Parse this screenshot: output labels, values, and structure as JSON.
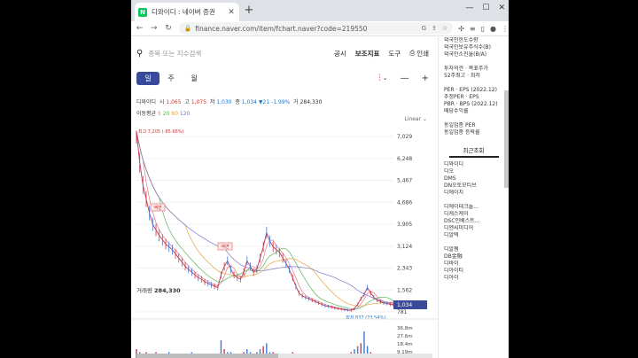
{
  "browser": {
    "tab_title": "디와이디 : 네이버 증권",
    "url": "finance.naver.com/item/fchart.naver?code=219550",
    "new_tab": "+",
    "tab_close": "✕"
  },
  "search": {
    "placeholder": "종목 또는 지수검색"
  },
  "menu": {
    "notice": "공시",
    "indicator": "보조지표",
    "tools": "도구",
    "print": "인쇄"
  },
  "periods": {
    "day": "일",
    "week": "주",
    "month": "월"
  },
  "stock": {
    "name": "디와이디",
    "open_label": "시",
    "open": "1,065",
    "high_label": "고",
    "high": "1,075",
    "low_label": "저",
    "low": "1,030",
    "close_label": "종",
    "close": "1,034",
    "change": "▼21",
    "change_pct": "-1.99%",
    "volume_label": "거",
    "volume": "284,330"
  },
  "ma": {
    "label": "이동평균",
    "v5": "5",
    "v20": "20",
    "v60": "60",
    "v120": "120"
  },
  "scale_mode": "Linear",
  "chart_data": {
    "type": "line",
    "y_ticks": [
      "7,029",
      "6,248",
      "5,467",
      "4,686",
      "3,905",
      "3,124",
      "2,343",
      "1,562",
      "781"
    ],
    "x_ticks": [
      "4월",
      "8월",
      "2022",
      "4월",
      "8월",
      "2023",
      "4월"
    ],
    "ylim": [
      781,
      7029
    ],
    "high_label": "최고 7,205 (-85.66%)",
    "low_label": "최저 837 (23.54%)",
    "last_price": "1,034",
    "annotations": [
      "액면",
      "액면"
    ],
    "price_series": [
      7205,
      6100,
      5300,
      4800,
      4300,
      3900,
      3700,
      3500,
      3350,
      3200,
      3100,
      3000,
      2850,
      2700,
      2550,
      2400,
      2300,
      2200,
      2100,
      2000,
      1950,
      1850,
      1800,
      1750,
      1700,
      1650,
      2100,
      2400,
      2600,
      2300,
      2100,
      2000,
      1950,
      2200,
      2600,
      2400,
      2200,
      2300,
      2700,
      3100,
      3600,
      3300,
      3100,
      3000,
      2900,
      2700,
      2500,
      2300,
      2000,
      1700,
      1450,
      1350,
      1300,
      1250,
      1200,
      1150,
      1100,
      1050,
      1000,
      980,
      950,
      920,
      900,
      880,
      860,
      845,
      837,
      900,
      1050,
      1250,
      1400,
      1650,
      1450,
      1300,
      1200,
      1150,
      1100,
      1080,
      1050,
      1034
    ],
    "volume_axis": [
      "36.8m",
      "27.6m",
      "18.4m",
      "9.19m"
    ],
    "volume_label": "거래량",
    "volume_value": "284,330",
    "volume_series": [
      3,
      2,
      1,
      2,
      1,
      1,
      2,
      1,
      1,
      1,
      2,
      1,
      1,
      1,
      1,
      1,
      1,
      2,
      1,
      1,
      1,
      1,
      1,
      1,
      1,
      1,
      6,
      3,
      2,
      2,
      1,
      1,
      1,
      2,
      3,
      2,
      1,
      2,
      3,
      4,
      5,
      2,
      2,
      1,
      1,
      1,
      1,
      1,
      2,
      1,
      1,
      1,
      1,
      1,
      1,
      1,
      1,
      1,
      1,
      1,
      1,
      1,
      1,
      1,
      1,
      1,
      2,
      3,
      4,
      5,
      9,
      4,
      2,
      1,
      1,
      1,
      1,
      1,
      1,
      1
    ],
    "colors": {
      "price": "#d2324a",
      "ma5": "#e07b7b",
      "ma20": "#5bb35b",
      "ma60": "#e6a23c",
      "ma120": "#7b74c9",
      "last": "#3a4a9a"
    }
  },
  "sidebar": {
    "top_items": [
      "외국인한도수량",
      "외국인보유주식수(B)",
      "외국인소진율(B/A)",
      "",
      "투자의견 · 목표주가",
      "52주최고 · 최저",
      "",
      "PER · EPS (2022.12)",
      "추정PER · EPS",
      "PBR · BPS (2022.12)",
      "배당수익률",
      "",
      "동일업종 PER",
      "동일업종 등락률"
    ],
    "recent_title": "최근조회",
    "recent_items": [
      "디와이디",
      "디오",
      "DMS",
      "DN오토모티브",
      "디에이치",
      "",
      "디에이테크놀...",
      "디케스케이",
      "DSC인베스트...",
      "디엔씨미디어",
      "디알텍",
      "",
      "디알젬",
      "DB金融",
      "디바이",
      "디아이티",
      "디아이"
    ]
  }
}
